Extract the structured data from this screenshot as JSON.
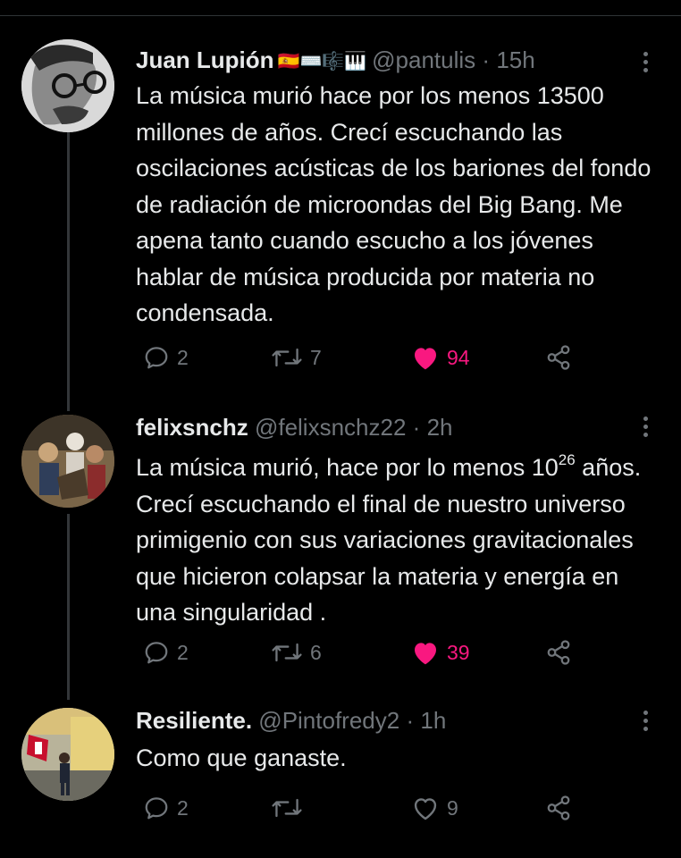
{
  "tweets": [
    {
      "name": "Juan Lupión",
      "flags": "🇪🇸⌨️🎼🎹",
      "handle": "@pantulis",
      "dot": "·",
      "time": "15h",
      "body": "La música murió hace por los menos 13500 millones de años.  Crecí escuchando las oscilaciones acústicas de los bariones del fondo de radiación de microondas del Big Bang.  Me apena tanto cuando escucho a los jóvenes hablar de música producida por materia no condensada.",
      "replies": "2",
      "retweets": "7",
      "likes": "94",
      "liked": true,
      "avatar": "avatar-man-glasses"
    },
    {
      "name": "felixsnchz",
      "handle": "@felixsnchz22",
      "dot": "·",
      "time": "2h",
      "body_pre": "La música murió, hace por lo menos 10",
      "body_sup": "26",
      "body_post": " años. Crecí escuchando el final de nuestro universo primigenio con sus variaciones gravitacionales que hicieron colapsar la materia y energía en una singularidad .",
      "replies": "2",
      "retweets": "6",
      "likes": "39",
      "liked": true,
      "avatar": "avatar-group-photo"
    },
    {
      "name": "Resiliente.",
      "handle": "@Pintofredy2",
      "dot": "·",
      "time": "1h",
      "body": "Como que ganaste.",
      "replies": "2",
      "retweets": "",
      "likes": "9",
      "liked": false,
      "avatar": "avatar-street-flag"
    }
  ],
  "icons": {
    "reply": "reply-icon",
    "retweet": "retweet-icon",
    "like": "heart-icon",
    "share": "share-icon",
    "more": "more-options-icon"
  },
  "colors": {
    "background": "#000000",
    "text": "#e7e9ea",
    "muted": "#71767b",
    "like": "#f91880",
    "divider": "#2f3336"
  }
}
